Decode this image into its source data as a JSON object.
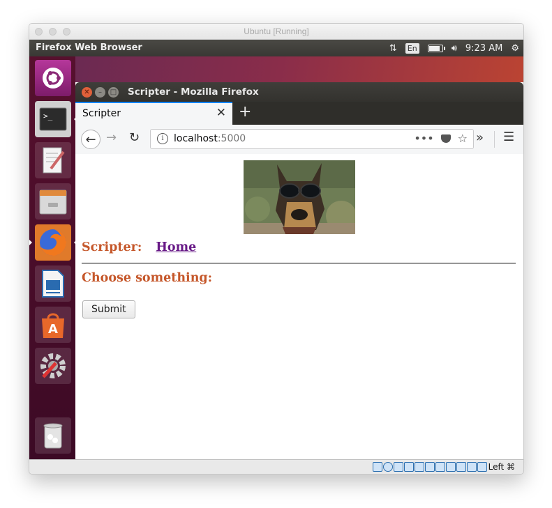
{
  "vm_window": {
    "title": "Ubuntu [Running]",
    "host_key": "Left ⌘"
  },
  "top_panel": {
    "app_name": "Firefox Web Browser",
    "keyboard_layout": "En",
    "time": "9:23 AM"
  },
  "launcher": {
    "items": [
      {
        "name": "Ubuntu Dash"
      },
      {
        "name": "Terminal"
      },
      {
        "name": "Text Editor"
      },
      {
        "name": "Files"
      },
      {
        "name": "Firefox"
      },
      {
        "name": "LibreOffice Writer"
      },
      {
        "name": "Ubuntu Software"
      },
      {
        "name": "System Settings"
      },
      {
        "name": "Trash"
      }
    ]
  },
  "firefox": {
    "window_title": "Scripter - Mozilla Firefox",
    "tab_title": "Scripter",
    "url_host": "localhost",
    "url_port": ":5000",
    "accent": "#0a84ff"
  },
  "page": {
    "header_label": "Scripter:",
    "home_link": "Home",
    "prompt": "Choose something:",
    "submit_label": "Submit",
    "colors": {
      "heading": "#c5572a",
      "link": "#681a87"
    }
  }
}
